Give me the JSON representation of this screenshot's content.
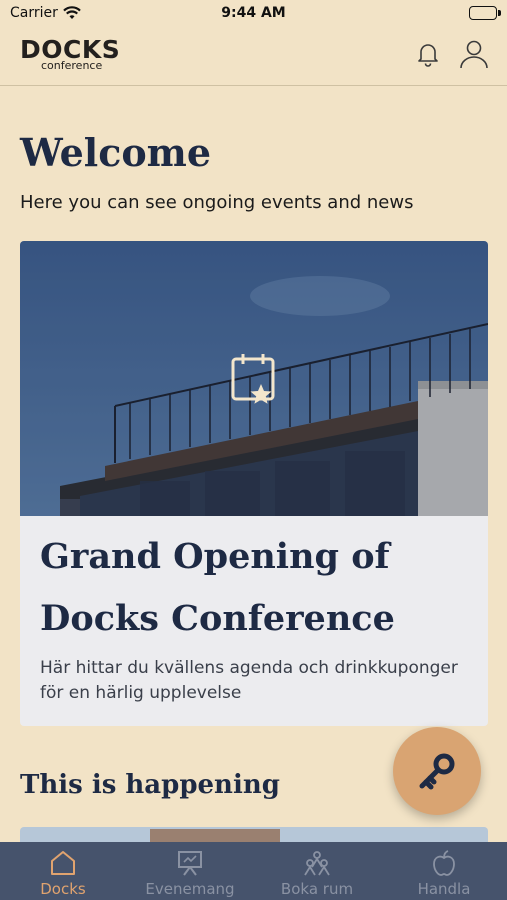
{
  "status_bar": {
    "carrier": "Carrier",
    "time": "9:44 AM",
    "battery_level": 1.0
  },
  "header": {
    "logo_main": "DOCKS",
    "logo_sub": "conference",
    "icons": [
      "bell-icon",
      "profile-icon"
    ]
  },
  "welcome": {
    "title": "Welcome",
    "subtitle": "Here you can see ongoing events and news"
  },
  "event_card": {
    "badge_icon": "calendar-star-icon",
    "title": "Grand Opening of Docks Conference",
    "description": "Här hittar du kvällens agenda och drinkkuponger för en härlig upplevelse"
  },
  "section": {
    "title": "This is happening"
  },
  "fab": {
    "icon": "key-icon"
  },
  "colors": {
    "background": "#f2e3c6",
    "navy": "#1e2a44",
    "accent": "#e0a36f",
    "tab_bar": "#46536c"
  },
  "tabs": [
    {
      "label": "Docks",
      "icon": "home-icon",
      "active": true
    },
    {
      "label": "Evenemang",
      "icon": "presentation-icon",
      "active": false
    },
    {
      "label": "Boka rum",
      "icon": "people-icon",
      "active": false
    },
    {
      "label": "Handla",
      "icon": "apple-icon",
      "active": false
    }
  ]
}
